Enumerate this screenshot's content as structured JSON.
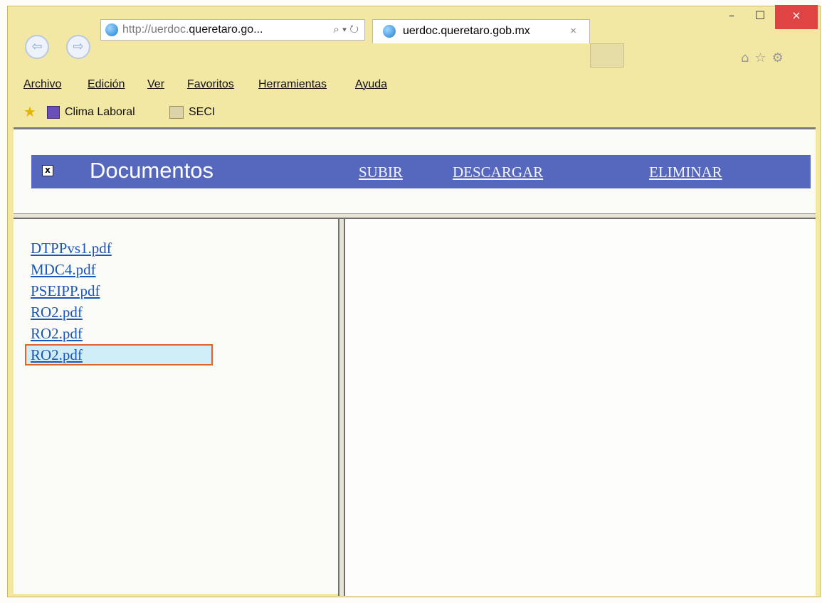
{
  "browser": {
    "address": {
      "scheme": "http://uerdoc.",
      "host": "queretaro.go...",
      "tools": "⌕ ▾ ↻"
    },
    "tab": {
      "title": "uerdoc.queretaro.gob.mx",
      "close": "×"
    },
    "nav": {
      "back": "⇦",
      "forward": "⇨"
    },
    "window": {
      "minimize": "–",
      "maximize": "☐",
      "close": "×"
    },
    "right_icons": "⌂☆⚙"
  },
  "menu": [
    "Archivo",
    "Edición",
    "Ver",
    "Favoritos",
    "Herramientas",
    "Ayuda"
  ],
  "favorites": {
    "star": "★",
    "items": [
      "Clima Laboral",
      "SECI"
    ]
  },
  "header": {
    "broken_image": "x",
    "title": "Documentos",
    "links": [
      "SUBIR",
      "DESCARGAR",
      "ELIMINAR"
    ]
  },
  "files": [
    "DTPPvs1.pdf",
    "MDC4.pdf",
    "PSEIPP.pdf",
    "RO2.pdf",
    "RO2.pdf",
    "RO2.pdf"
  ],
  "selected_file_index": 5,
  "colors": {
    "title_bar": "#f3e7a4",
    "header_bar": "#5668be",
    "link": "#1a55b9",
    "selection_fill": "#cfeef8",
    "selection_border": "#e2632d",
    "close_button": "#e04343"
  },
  "icons": {
    "back": "back-arrow-icon",
    "forward": "forward-arrow-icon",
    "site": "ie-globe-icon",
    "home": "home-icon",
    "favorites": "star-icon",
    "settings": "gear-icon"
  }
}
